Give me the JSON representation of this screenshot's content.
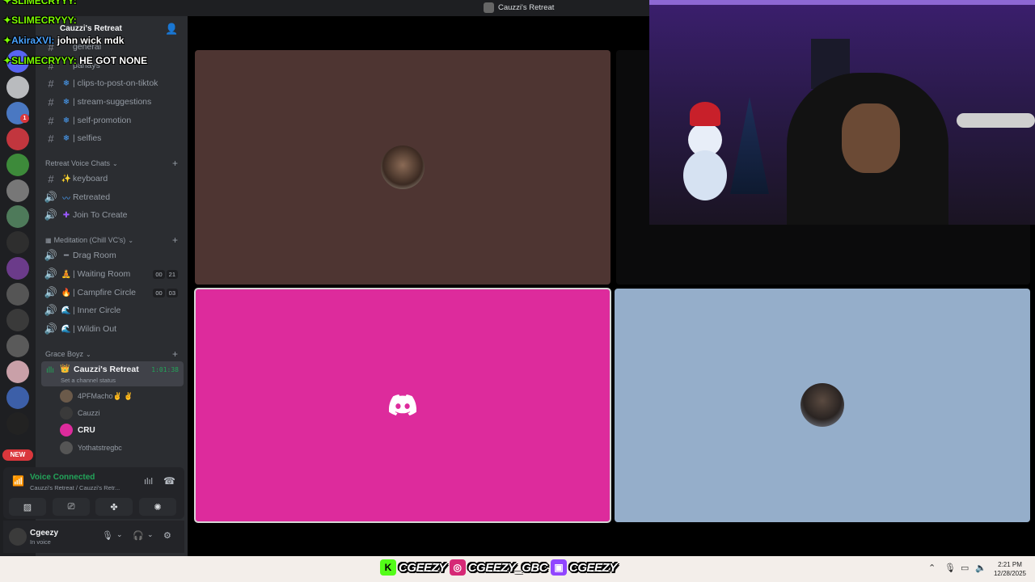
{
  "server": {
    "name": "Cauzzi's Retreat"
  },
  "window_title": "Cauzzi's Retreat",
  "chat": [
    {
      "user": "SLIMECRYYY:",
      "message": ""
    },
    {
      "user": "SLIMECRYYY:",
      "message": ""
    },
    {
      "user": "AkiraXVI:",
      "message": "john wick mdk"
    },
    {
      "user": "SLIMECRYYY:",
      "message": "HE GOT NONE"
    }
  ],
  "channels_top": [
    {
      "prefix": "#",
      "label": "general"
    },
    {
      "prefix": "#",
      "label": "parlays"
    },
    {
      "prefix": "#",
      "label": "| clips-to-post-on-tiktok"
    },
    {
      "prefix": "#",
      "label": "| stream-suggestions"
    },
    {
      "prefix": "#",
      "label": "| self-promotion"
    },
    {
      "prefix": "#",
      "label": "| selfies"
    }
  ],
  "category_voice": {
    "label": "Retreat Voice Chats"
  },
  "voice_channels": [
    {
      "prefix": "#",
      "label": "keyboard"
    },
    {
      "prefix": "🔊",
      "label": "Retreated"
    },
    {
      "prefix": "🔊",
      "label": "Join To Create"
    }
  ],
  "category_meditation": {
    "label": "Meditation (Chill VC's)"
  },
  "meditation_channels": [
    {
      "label": "Drag Room",
      "counts": []
    },
    {
      "label": "| Waiting Room",
      "counts": [
        "00",
        "21"
      ]
    },
    {
      "label": "| Campfire Circle",
      "counts": [
        "00",
        "03"
      ]
    },
    {
      "label": "| Inner Circle",
      "counts": []
    },
    {
      "label": "| Wildin Out",
      "counts": []
    }
  ],
  "category_grace": {
    "label": "Grace Boyz"
  },
  "active_channel": {
    "label": "Cauzzi's Retreat",
    "status": "Set a channel status",
    "timer": "1:01:38"
  },
  "members": [
    "4PFMacho✌ ✌",
    "Cauzzi",
    "CRU",
    "Yothatstregbc"
  ],
  "voice_panel": {
    "status": "Voice Connected",
    "location": "Cauzzi's Retreat / Cauzzi's Retr..."
  },
  "user": {
    "name": "Cgeezy",
    "status": "In voice"
  },
  "rail": {
    "new_label": "NEW",
    "badge": "1"
  },
  "socials": [
    {
      "platform": "kick",
      "handle": "CGEEZY",
      "color": "#53fc18",
      "glyph": "K"
    },
    {
      "platform": "instagram",
      "handle": "CGEEZY_GBC",
      "color": "#d62976",
      "glyph": "◎"
    },
    {
      "platform": "twitch",
      "handle": "CGEEZY",
      "color": "#9146ff",
      "glyph": "▣"
    }
  ],
  "clock": {
    "time": "2:21 PM",
    "date": "12/28/2025"
  },
  "colors": {
    "tile1": "#4e3532",
    "tile2": "#dd2b9c",
    "tile3": "#95aeca",
    "accent_green": "#23a55a"
  }
}
